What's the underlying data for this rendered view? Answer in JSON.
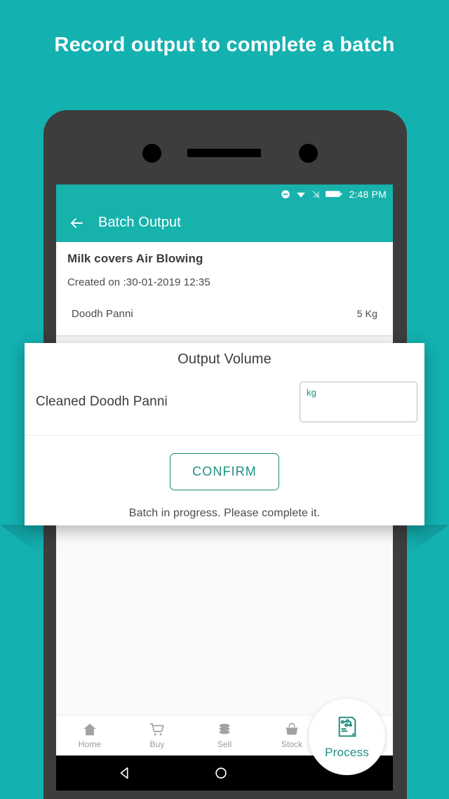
{
  "headline": "Record output to complete a batch",
  "colors": {
    "background_teal": "#14b1b1",
    "appbar_teal": "#17b2ac",
    "accent_green": "#1c8f7e",
    "phone_frame": "#3d3d3d",
    "screen_bg": "#fafafa"
  },
  "phone": {
    "status_bar": {
      "time": "2:48 PM",
      "icons": [
        "do-not-disturb-icon",
        "wifi-icon",
        "signal-off-icon",
        "battery-icon"
      ]
    },
    "app_bar": {
      "back_icon": "back-arrow-icon",
      "title": "Batch Output"
    },
    "batch_card": {
      "title": "Milk covers Air Blowing",
      "created": "Created on :30-01-2019 12:35",
      "items": [
        {
          "name": "Doodh Panni",
          "quantity": "5 Kg"
        }
      ]
    },
    "bottom_nav": {
      "items": [
        {
          "label": "Home",
          "icon": "home-icon"
        },
        {
          "label": "Buy",
          "icon": "shopping-cart-icon"
        },
        {
          "label": "Sell",
          "icon": "coins-stack-icon"
        },
        {
          "label": "Stock",
          "icon": "basket-icon"
        }
      ],
      "active": {
        "label": "Process",
        "icon": "process-document-icon"
      }
    },
    "system_nav": {
      "back_icon": "android-back-icon",
      "home_icon": "android-home-icon"
    }
  },
  "dialog": {
    "title": "Output Volume",
    "row": {
      "label": "Cleaned Doodh Panni",
      "input_value": "",
      "input_unit": "kg"
    },
    "confirm_label": "CONFIRM",
    "footnote": "Batch in progress. Please complete it."
  }
}
